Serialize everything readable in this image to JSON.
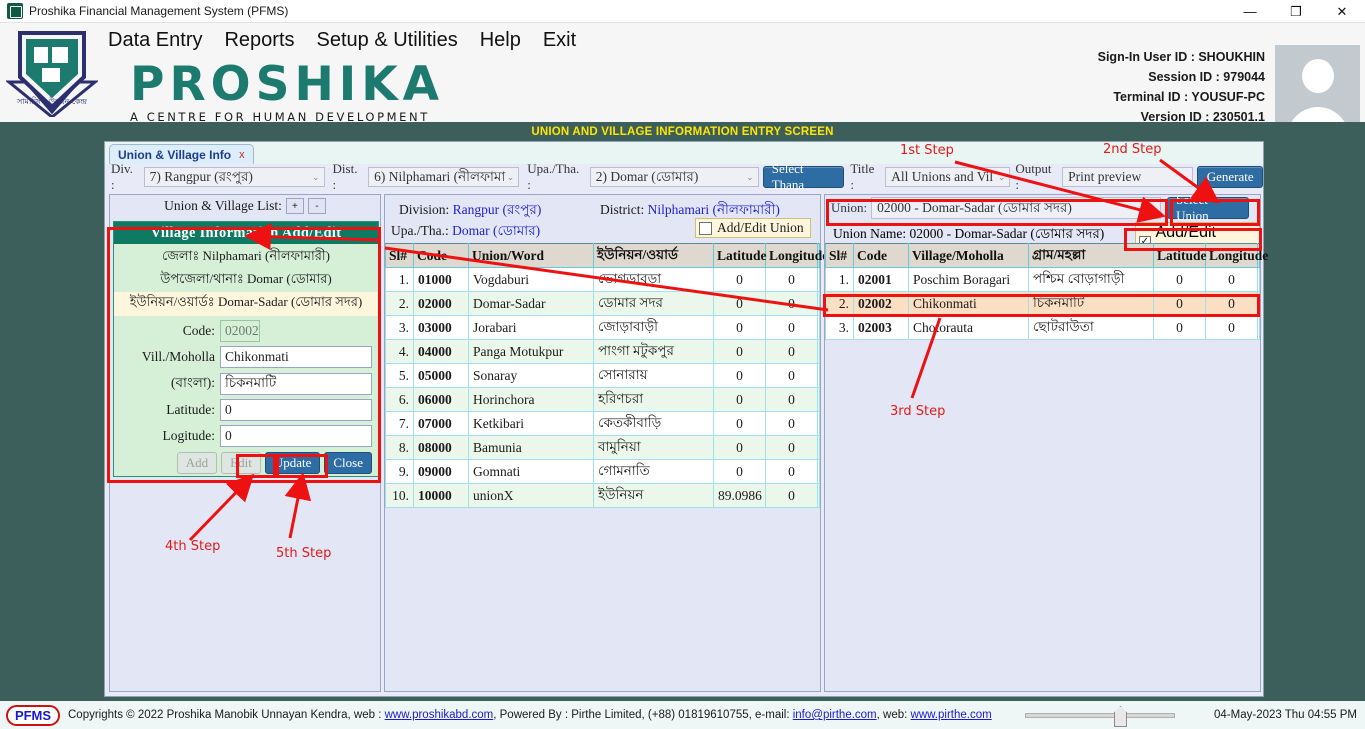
{
  "window": {
    "title": "Proshika Financial Management System (PFMS)",
    "icon": "app-icon",
    "controls": {
      "minimize": "—",
      "maximize": "❐",
      "close": "✕"
    }
  },
  "header": {
    "brand_name": "PROSHIKA",
    "brand_tagline": "A CENTRE FOR HUMAN DEVELOPMENT",
    "menu": [
      {
        "label": "Data Entry"
      },
      {
        "label": "Reports"
      },
      {
        "label": "Setup & Utilities"
      },
      {
        "label": "Help"
      },
      {
        "label": "Exit"
      }
    ],
    "session": {
      "user_label": "Sign-In User ID :  SHOUKHIN",
      "session_label": "Session ID :  979044",
      "terminal_label": "Terminal ID :  YOUSUF-PC",
      "version_label": "Version ID :  230501.1"
    }
  },
  "screen_title": "UNION AND VILLAGE INFORMATION ENTRY SCREEN",
  "tab": {
    "label": "Union & Village Info",
    "close": "x"
  },
  "toolbar": {
    "div_label": "Div. :",
    "div_value": "7) Rangpur (রংপুর)",
    "dist_label": "Dist. :",
    "dist_value": "6) Nilphamari (নীলফামা",
    "upa_label": "Upa./Tha. :",
    "upa_value": "2) Domar (ডোমার)",
    "select_thana": "Select Thana",
    "title_label": "Title :",
    "title_value": "All Unions and Vil",
    "output_label": "Output :",
    "output_value": "Print preview",
    "generate": "Generate",
    "caret": "⌄"
  },
  "left_panel": {
    "list_label": "Union & Village List:",
    "plus_button": "+",
    "minus_button": "-",
    "box_title": "Village Information Add/Edit",
    "district_line": "জেলাঃ Nilphamari (নীলফামারী)",
    "upazila_line": "উপজেলা/থানাঃ Domar (ডোমার)",
    "union_line": "ইউনিয়ন/ওয়ার্ডঃ Domar-Sadar (ডোমার সদর)",
    "fields": [
      {
        "label": "Code:",
        "value": "02002",
        "readonly": true
      },
      {
        "label": "Vill./Moholla",
        "value": "Chikonmati",
        "readonly": false
      },
      {
        "label": "(বাংলা):",
        "value": "চিকনমাটি",
        "readonly": false
      },
      {
        "label": "Latitude:",
        "value": "0",
        "readonly": false
      },
      {
        "label": "Logitude:",
        "value": "0",
        "readonly": false
      }
    ],
    "buttons": [
      {
        "label": "Add",
        "enabled": false
      },
      {
        "label": "Edit",
        "enabled": false
      },
      {
        "label": "Update",
        "enabled": true
      },
      {
        "label": "Close",
        "enabled": true
      }
    ]
  },
  "center_panel": {
    "division_label": "Division:",
    "division_value": "Rangpur (রংপুর)",
    "district_label": "District:",
    "district_value": "Nilphamari (নীলফামারী)",
    "upa_label": "Upa./Tha.:",
    "upa_value": "Domar (ডোমার)",
    "add_edit_union": "Add/Edit Union",
    "add_edit_union_checked": false,
    "columns": [
      "Sl#",
      "Code",
      "Union/Word",
      "ইউনিয়ন/ওয়ার্ড",
      "Latitude",
      "Longitude",
      ""
    ],
    "rows": [
      {
        "sl": "1.",
        "code": "01000",
        "name": "Vogdaburi",
        "bn": "ভোগডাবুড়া",
        "lat": "0",
        "lon": "0"
      },
      {
        "sl": "2.",
        "code": "02000",
        "name": "Domar-Sadar",
        "bn": "ডোমার সদর",
        "lat": "0",
        "lon": "0"
      },
      {
        "sl": "3.",
        "code": "03000",
        "name": "Jorabari",
        "bn": "জোড়াবাড়ী",
        "lat": "0",
        "lon": "0"
      },
      {
        "sl": "4.",
        "code": "04000",
        "name": "Panga Motukpur",
        "bn": "পাংগা মটুকপুর",
        "lat": "0",
        "lon": "0"
      },
      {
        "sl": "5.",
        "code": "05000",
        "name": "Sonaray",
        "bn": "সোনারায়",
        "lat": "0",
        "lon": "0"
      },
      {
        "sl": "6.",
        "code": "06000",
        "name": "Horinchora",
        "bn": "হরিণচরা",
        "lat": "0",
        "lon": "0"
      },
      {
        "sl": "7.",
        "code": "07000",
        "name": "Ketkibari",
        "bn": "কেতকীবাড়ি",
        "lat": "0",
        "lon": "0"
      },
      {
        "sl": "8.",
        "code": "08000",
        "name": "Bamunia",
        "bn": "বামুনিয়া",
        "lat": "0",
        "lon": "0"
      },
      {
        "sl": "9.",
        "code": "09000",
        "name": "Gomnati",
        "bn": "গোমনাতি",
        "lat": "0",
        "lon": "0"
      },
      {
        "sl": "10.",
        "code": "10000",
        "name": "unionX",
        "bn": "ইউনিয়ন",
        "lat": "89.0986",
        "lon": "0"
      }
    ]
  },
  "right_panel": {
    "union_label": "Union:",
    "union_value": "02000 - Domar-Sadar (ডোমার সদর)",
    "select_union": "Select Union",
    "union_name_label": "Union Name:",
    "union_name_value": "02000 - Domar-Sadar (ডোমার সদর)",
    "add_edit_village": "Add/Edit Village",
    "add_edit_village_checked": true,
    "columns": [
      "Sl#",
      "Code",
      "Village/Moholla",
      "গ্রাম/মহল্লা",
      "Latitude",
      "Longitude",
      ""
    ],
    "rows": [
      {
        "sl": "1.",
        "code": "02001",
        "name": "Poschim Boragari",
        "bn": "পশ্চিম বোড়াগাড়ী",
        "lat": "0",
        "lon": "0",
        "selected": false
      },
      {
        "sl": "2.",
        "code": "02002",
        "name": "Chikonmati",
        "bn": "চিকনমাটি",
        "lat": "0",
        "lon": "0",
        "selected": true
      },
      {
        "sl": "3.",
        "code": "02003",
        "name": "Chotorauta",
        "bn": "ছোটরাউতা",
        "lat": "0",
        "lon": "0",
        "selected": false
      }
    ]
  },
  "annotations": [
    {
      "id": "step1",
      "text": "1st Step"
    },
    {
      "id": "step2",
      "text": "2nd Step"
    },
    {
      "id": "step3",
      "text": "3rd Step"
    },
    {
      "id": "step4",
      "text": "4th Step"
    },
    {
      "id": "step5",
      "text": "5th Step"
    }
  ],
  "statusbar": {
    "badge": "PFMS",
    "copyright_pre": "Copyrights © 2022 Proshika Manobik Unnayan Kendra, web : ",
    "link_web1": "www.proshikabd.com",
    "mid": ", Powered By : Pirthe Limited, (+88) 01819610755, e-mail: ",
    "link_mail": "info@pirthe.com",
    "mid2": ", web: ",
    "link_web2": "www.pirthe.com",
    "datetime": "04-May-2023 Thu 04:55 PM"
  },
  "colors": {
    "brand_teal": "#1d7a6e",
    "header_band": "#3c5f5c",
    "accent_blue": "#2e6da4",
    "annotation_red": "#ee1111",
    "title_yellow": "#ffe600",
    "selected_row": "#fbdfc2"
  }
}
